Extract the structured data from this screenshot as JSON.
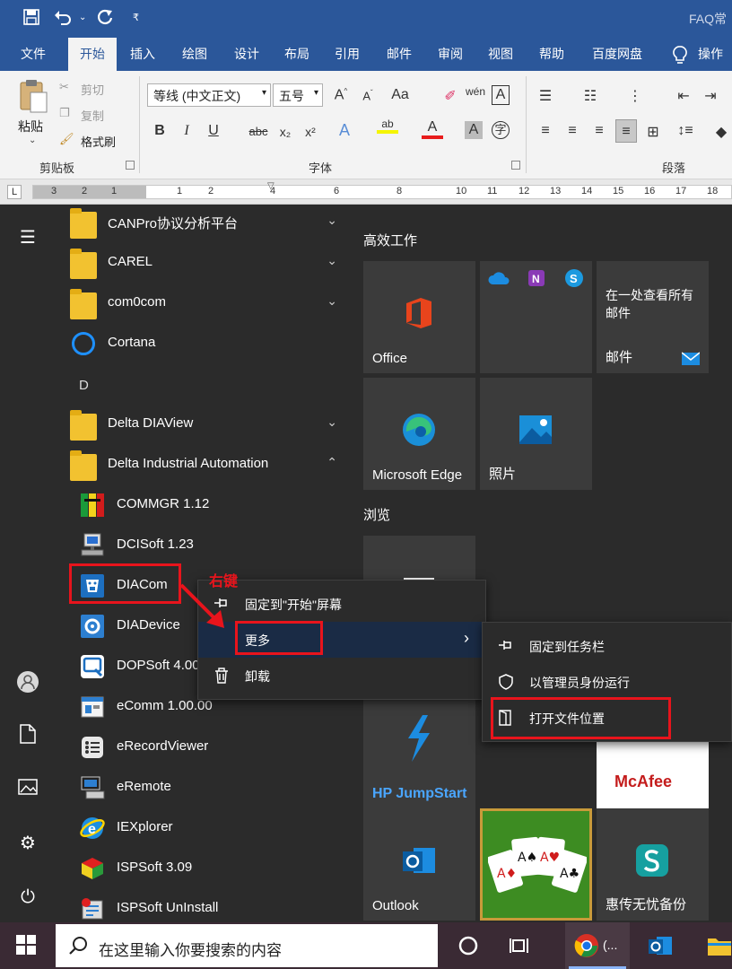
{
  "titlebar": {
    "title": "FAQ常"
  },
  "ribbon": {
    "tabs": [
      "文件",
      "开始",
      "插入",
      "绘图",
      "设计",
      "布局",
      "引用",
      "邮件",
      "审阅",
      "视图",
      "帮助",
      "百度网盘",
      "操作"
    ],
    "active_tab": "开始",
    "clipboard": {
      "paste": "粘贴",
      "cut": "剪切",
      "copy": "复制",
      "format_painter": "格式刷",
      "group": "剪贴板"
    },
    "font": {
      "name": "等线 (中文正文)",
      "size": "五号",
      "group": "字体"
    },
    "paragraph": {
      "group": "段落"
    }
  },
  "ruler": {
    "ticks": [
      "3",
      "2",
      "1",
      "",
      "1",
      "2",
      "",
      "4",
      "",
      "6",
      "",
      "8",
      "",
      "10",
      "11",
      "12",
      "13",
      "14",
      "15",
      "16",
      "17",
      "18"
    ]
  },
  "start_menu": {
    "apps": [
      {
        "label": "CANPro协议分析平台",
        "icon": "folder-icon",
        "expandable": true
      },
      {
        "label": "CAREL",
        "icon": "folder-icon",
        "expandable": true
      },
      {
        "label": "com0com",
        "icon": "folder-icon",
        "expandable": true
      },
      {
        "label": "Cortana",
        "icon": "cortana-icon"
      },
      {
        "letter": "D"
      },
      {
        "label": "Delta DIAView",
        "icon": "folder-icon",
        "expandable": true
      },
      {
        "label": "Delta Industrial Automation",
        "icon": "folder-icon",
        "expanded": true
      },
      {
        "label": "COMMGR 1.12",
        "icon": "commgr-icon",
        "sub": true
      },
      {
        "label": "DCISoft 1.23",
        "icon": "dcisoft-icon",
        "sub": true
      },
      {
        "label": "DIACom",
        "icon": "diacom-icon",
        "sub": true
      },
      {
        "label": "DIADevice",
        "icon": "diadevice-icon",
        "sub": true
      },
      {
        "label": "DOPSoft 4.00",
        "icon": "dopsoft-icon",
        "sub": true
      },
      {
        "label": "eComm 1.00.00",
        "icon": "ecomm-icon",
        "sub": true
      },
      {
        "label": "eRecordViewer",
        "icon": "erecordviewer-icon",
        "sub": true
      },
      {
        "label": "eRemote",
        "icon": "eremote-icon",
        "sub": true
      },
      {
        "label": "IEXplorer",
        "icon": "iexplorer-icon",
        "sub": true
      },
      {
        "label": "ISPSoft 3.09",
        "icon": "ispsoft-icon",
        "sub": true
      },
      {
        "label": "ISPSoft UnInstall",
        "icon": "ispsoft-uninstall-icon",
        "sub": true
      }
    ],
    "tile_groups": [
      {
        "title": "高效工作"
      },
      {
        "title": "浏览"
      }
    ],
    "tiles": [
      {
        "label": "Office",
        "icon": "office-icon"
      },
      {
        "label": "",
        "icon": "office-apps-icon"
      },
      {
        "label": "邮件",
        "subtitle": "在一处查看所有邮件",
        "icon": "mail-icon"
      },
      {
        "label": "Microsoft Edge",
        "icon": "edge-icon"
      },
      {
        "label": "照片",
        "icon": "photos-icon"
      },
      {
        "label": "",
        "icon": "store-icon"
      },
      {
        "label": "HP JumpStart",
        "icon": "hp-jumpstart-icon"
      },
      {
        "label": "McAfee",
        "icon": "mcafee-icon"
      },
      {
        "label": "Outlook",
        "icon": "outlook-icon"
      },
      {
        "label": "",
        "icon": "solitaire-icon"
      },
      {
        "label": "惠传无忧备份",
        "icon": "backup-icon"
      }
    ],
    "context_menu": [
      {
        "label": "固定到\"开始\"屏幕",
        "icon": "pin-icon"
      },
      {
        "label": "更多",
        "icon": "",
        "submenu": true
      },
      {
        "label": "卸载",
        "icon": "trash-icon"
      }
    ],
    "submenu": [
      {
        "label": "固定到任务栏",
        "icon": "pin-icon"
      },
      {
        "label": "以管理员身份运行",
        "icon": "shield-icon"
      },
      {
        "label": "打开文件位置",
        "icon": "folder-open-icon"
      }
    ],
    "annotation": "右键"
  },
  "taskbar": {
    "search_placeholder": "在这里输入你要搜索的内容",
    "chrome_label": "(..."
  },
  "colors": {
    "word_blue": "#2b579a",
    "start_bg": "#2b2b2b",
    "annotation_red": "#e8141c",
    "accent_blue": "#0078d7"
  }
}
